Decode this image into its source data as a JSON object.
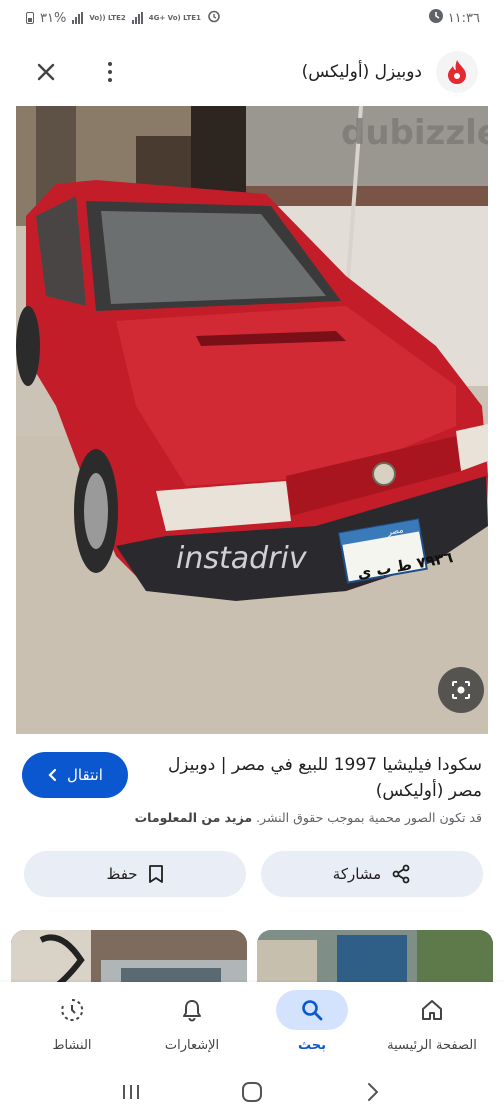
{
  "status_bar": {
    "battery": "٣١%",
    "net1": "Vo)) LTE2",
    "net2": "4G+ Vo) LTE1",
    "time": "١١:٣٦"
  },
  "header": {
    "site_title": "دوبيزل (أوليكس)",
    "logo_color": "#e5292e"
  },
  "image": {
    "watermark_top": "dubizzle",
    "watermark_center": "instadriv",
    "plate_top": "مصر",
    "plate_number": "٧٩٣٦ ط ب ى",
    "car_color": "#c41d2a"
  },
  "result": {
    "title": "سكودا فيليشيا 1997 للبيع في مصر | دوبيزل مصر (أوليكس)",
    "visit_label": "انتقال",
    "copyright_text": "قد تكون الصور محمية بموجب حقوق النشر.",
    "more_info": "مزيد من المعلومات"
  },
  "actions": {
    "share_label": "مشاركة",
    "save_label": "حفظ"
  },
  "bottom_nav": {
    "items": [
      {
        "label": "الصفحة الرئيسية",
        "icon": "home-icon"
      },
      {
        "label": "بحث",
        "icon": "search-icon"
      },
      {
        "label": "الإشعارات",
        "icon": "bell-icon"
      },
      {
        "label": "النشاط",
        "icon": "activity-icon"
      }
    ]
  },
  "colors": {
    "accent": "#0b57d0",
    "pill_bg": "#e9eef6",
    "active_nav_bg": "#d3e3fd"
  }
}
